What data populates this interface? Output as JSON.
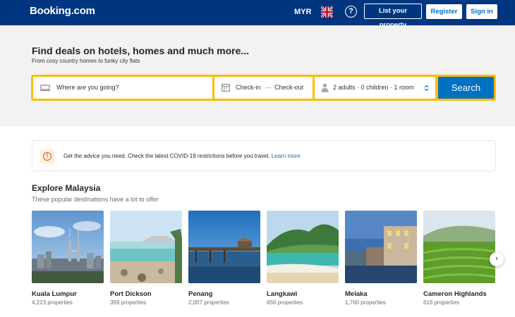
{
  "header": {
    "logo": "Booking.com",
    "currency": "MYR",
    "help_icon": "?",
    "list_property": "List your property",
    "register": "Register",
    "sign_in": "Sign in"
  },
  "hero": {
    "title": "Find deals on hotels, homes and much more...",
    "subtitle": "From cosy country homes to funky city flats"
  },
  "search": {
    "destination_placeholder": "Where are you going?",
    "check_in": "Check-in",
    "dash": "—",
    "check_out": "Check-out",
    "guests": "2 adults · 0 children · 1 room",
    "button": "Search"
  },
  "covid": {
    "text": "Get the advice you need. Check the latest COVID-19 restrictions before you travel.",
    "link": "Learn more",
    "icon": "!"
  },
  "explore": {
    "title": "Explore Malaysia",
    "subtitle": "These popular destinations have a lot to offer",
    "destinations": [
      {
        "name": "Kuala Lumpur",
        "count": "4,223 properties"
      },
      {
        "name": "Port Dickson",
        "count": "359 properties"
      },
      {
        "name": "Penang",
        "count": "2,007 properties"
      },
      {
        "name": "Langkawi",
        "count": "656 properties"
      },
      {
        "name": "Melaka",
        "count": "1,760 properties"
      },
      {
        "name": "Cameron Highlands",
        "count": "616 properties"
      }
    ]
  },
  "colors": {
    "brand": "#003580",
    "accent": "#0071c2",
    "search_border": "#febb02"
  },
  "icons": [
    "bed-icon",
    "calendar-icon",
    "person-icon",
    "updown-chevron-icon",
    "info-icon",
    "chevron-right-icon",
    "uk-flag-icon",
    "help-icon"
  ]
}
